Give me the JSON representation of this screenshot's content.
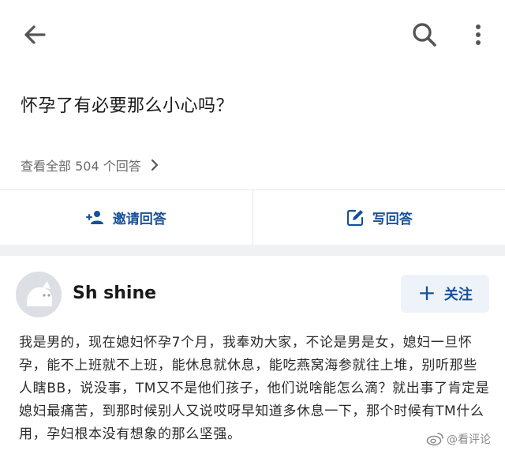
{
  "question": {
    "title": "怀孕了有必要那么小心吗？"
  },
  "answers_link": {
    "label": "查看全部 504 个回答"
  },
  "actions": {
    "invite_label": "邀请回答",
    "write_label": "写回答"
  },
  "author": {
    "name": "Sh shine",
    "follow_label": "关注",
    "follow_plus": "+"
  },
  "answer": {
    "text": "我是男的，现在媳妇怀孕7个月，我奉劝大家，不论是男是女，媳妇一旦怀孕，能不上班就不上班，能休息就休息，能吃燕窝海参就往上堆，别听那些人瞎BB，说没事，TM又不是他们孩子，他们说啥能怎么滴？就出事了肯定是媳妇最痛苦，到那时候别人又说哎呀早知道多休息一下，那个时候有TM什么用，孕妇根本没有想象的那么坚强。"
  },
  "watermark": {
    "text": "@看评论"
  },
  "colors": {
    "accent": "#175199",
    "follow_bg": "#eef3fa",
    "band": "#f0f1f3"
  },
  "icons": [
    "back-arrow-icon",
    "search-icon",
    "more-vertical-icon",
    "chevron-right-icon",
    "invite-user-icon",
    "edit-icon",
    "weibo-icon"
  ]
}
